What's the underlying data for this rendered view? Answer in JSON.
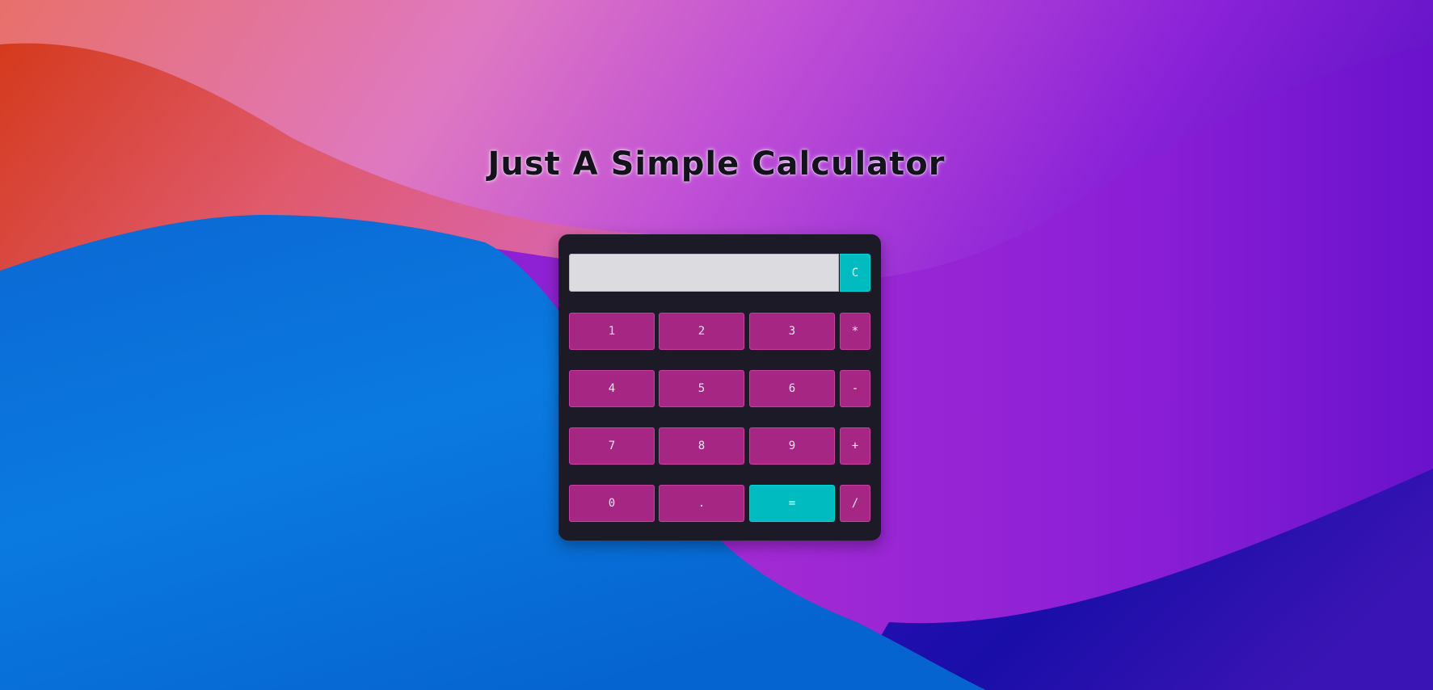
{
  "page": {
    "title": "Just A Simple Calculator"
  },
  "colors": {
    "panel": "#1c1a27",
    "key": "#a62684",
    "accent": "#00bcc0",
    "display": "#dcdbe0"
  },
  "calculator": {
    "display_value": "",
    "clear_label": "C",
    "rows": [
      [
        "1",
        "2",
        "3",
        "*"
      ],
      [
        "4",
        "5",
        "6",
        "-"
      ],
      [
        "7",
        "8",
        "9",
        "+"
      ],
      [
        "0",
        ".",
        "=",
        "/"
      ]
    ]
  }
}
